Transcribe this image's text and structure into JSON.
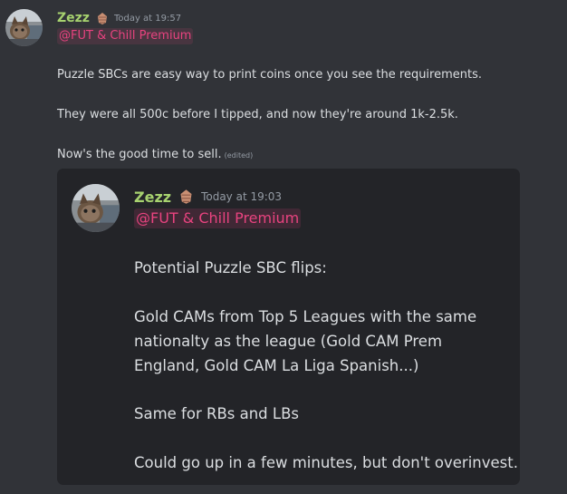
{
  "message": {
    "author": "Zezz",
    "badge_icon": "pinecone-badge-icon",
    "timestamp": "Today at 19:57",
    "mention": "@FUT & Chill Premium",
    "lines": [
      "Puzzle SBCs are easy way to print coins once you see the requirements.",
      "They were all 500c before I tipped, and now they're around 1k-2.5k.",
      "Now's the good time to sell."
    ],
    "edited_label": "(edited)"
  },
  "forwarded": {
    "author": "Zezz",
    "badge_icon": "pinecone-badge-icon",
    "timestamp": "Today at 19:03",
    "mention": "@FUT & Chill Premium",
    "lines": [
      "Potential Puzzle SBC flips:",
      "Gold CAMs from Top 5 Leagues with the same",
      "nationalty as the league (Gold CAM Prem",
      "England, Gold CAM La Liga Spanish...)",
      "Same for RBs and LBs",
      "Could go up in a few minutes, but don't overinvest."
    ]
  },
  "colors": {
    "background": "#313338",
    "embed_background": "#232428",
    "username": "#a7d26f",
    "mention": "#e8437f",
    "text": "#dbdee1",
    "muted": "#949ba4"
  }
}
